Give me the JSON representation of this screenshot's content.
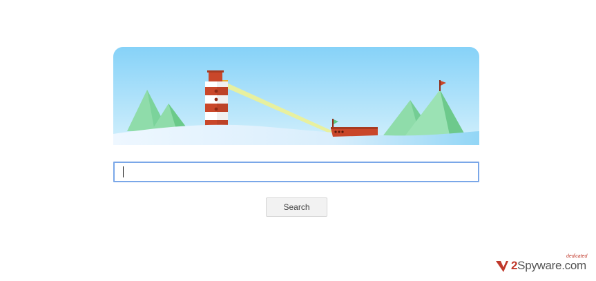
{
  "search": {
    "value": "",
    "button_label": "Search"
  },
  "banner": {
    "icons": [
      "lighthouse-icon",
      "boat-icon",
      "flag-icon",
      "mountain-icon"
    ],
    "colors": {
      "sky_top": "#87d3f8",
      "sky_bottom": "#c9ecfb",
      "lighthouse_red": "#c9472a",
      "mountain_green": "#6ccf8e",
      "light_beam": "#ecef9a"
    }
  },
  "watermark": {
    "prefix": "2",
    "name": "Spyware",
    "suffix": ".com",
    "tag": "dedicated"
  }
}
